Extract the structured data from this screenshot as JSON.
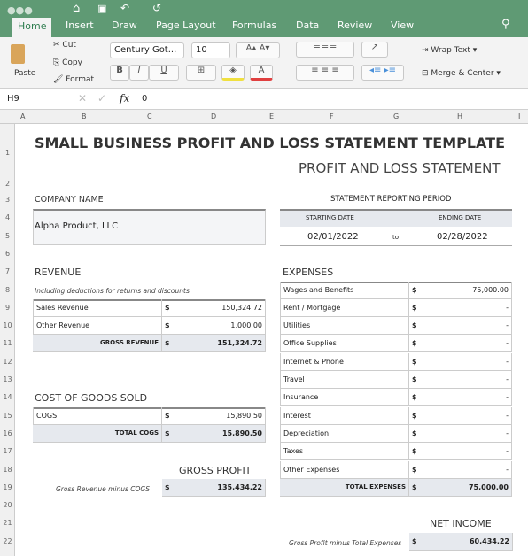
{
  "window": {
    "tabs": [
      "Home",
      "Insert",
      "Draw",
      "Page Layout",
      "Formulas",
      "Data",
      "Review",
      "View"
    ],
    "active_tab": "Home"
  },
  "ribbon": {
    "paste": "Paste",
    "cut": "Cut",
    "copy": "Copy",
    "format": "Format",
    "font": "Century Got...",
    "size": "10",
    "bold": "B",
    "italic": "I",
    "underline": "U",
    "wrap": "Wrap Text",
    "merge": "Merge & Center"
  },
  "formula_bar": {
    "cell": "H9",
    "value": "0",
    "fx": "fx"
  },
  "columns": [
    "A",
    "B",
    "C",
    "D",
    "E",
    "F",
    "G",
    "H",
    "I"
  ],
  "rows": [
    "1",
    "2",
    "3",
    "4",
    "5",
    "6",
    "7",
    "8",
    "9",
    "10",
    "11",
    "12",
    "13",
    "14",
    "15",
    "16",
    "17",
    "18",
    "19",
    "20",
    "21",
    "22"
  ],
  "sheet": {
    "title": "SMALL BUSINESS PROFIT AND LOSS STATEMENT TEMPLATE",
    "subtitle": "PROFIT AND LOSS STATEMENT",
    "company_label": "COMPANY NAME",
    "company": "Alpha Product, LLC",
    "period_label": "STATEMENT REPORTING PERIOD",
    "start_label": "STARTING DATE",
    "end_label": "ENDING DATE",
    "start": "02/01/2022",
    "to": "to",
    "end": "02/28/2022",
    "revenue": {
      "title": "REVENUE",
      "note": "Including deductions for returns and discounts",
      "items": [
        {
          "label": "Sales Revenue",
          "cur": "$",
          "value": "150,324.72"
        },
        {
          "label": "Other Revenue",
          "cur": "$",
          "value": "1,000.00"
        }
      ],
      "total_label": "GROSS REVENUE",
      "total_cur": "$",
      "total": "151,324.72"
    },
    "cogs": {
      "title": "COST OF GOODS SOLD",
      "items": [
        {
          "label": "COGS",
          "cur": "$",
          "value": "15,890.50"
        }
      ],
      "total_label": "TOTAL COGS",
      "total_cur": "$",
      "total": "15,890.50"
    },
    "gross": {
      "title": "GROSS PROFIT",
      "note": "Gross Revenue minus COGS",
      "cur": "$",
      "value": "135,434.22"
    },
    "expenses": {
      "title": "EXPENSES",
      "items": [
        {
          "label": "Wages and Benefits",
          "cur": "$",
          "value": "75,000.00"
        },
        {
          "label": "Rent / Mortgage",
          "cur": "$",
          "value": "-"
        },
        {
          "label": "Utilities",
          "cur": "$",
          "value": "-"
        },
        {
          "label": "Office Supplies",
          "cur": "$",
          "value": "-"
        },
        {
          "label": "Internet & Phone",
          "cur": "$",
          "value": "-"
        },
        {
          "label": "Travel",
          "cur": "$",
          "value": "-"
        },
        {
          "label": "Insurance",
          "cur": "$",
          "value": "-"
        },
        {
          "label": "Interest",
          "cur": "$",
          "value": "-"
        },
        {
          "label": "Depreciation",
          "cur": "$",
          "value": "-"
        },
        {
          "label": "Taxes",
          "cur": "$",
          "value": "-"
        },
        {
          "label": "Other Expenses",
          "cur": "$",
          "value": "-"
        }
      ],
      "total_label": "TOTAL EXPENSES",
      "total_cur": "$",
      "total": "75,000.00"
    },
    "net": {
      "title": "NET INCOME",
      "note": "Gross Profit minus Total Expenses",
      "cur": "$",
      "value": "60,434.22"
    }
  }
}
